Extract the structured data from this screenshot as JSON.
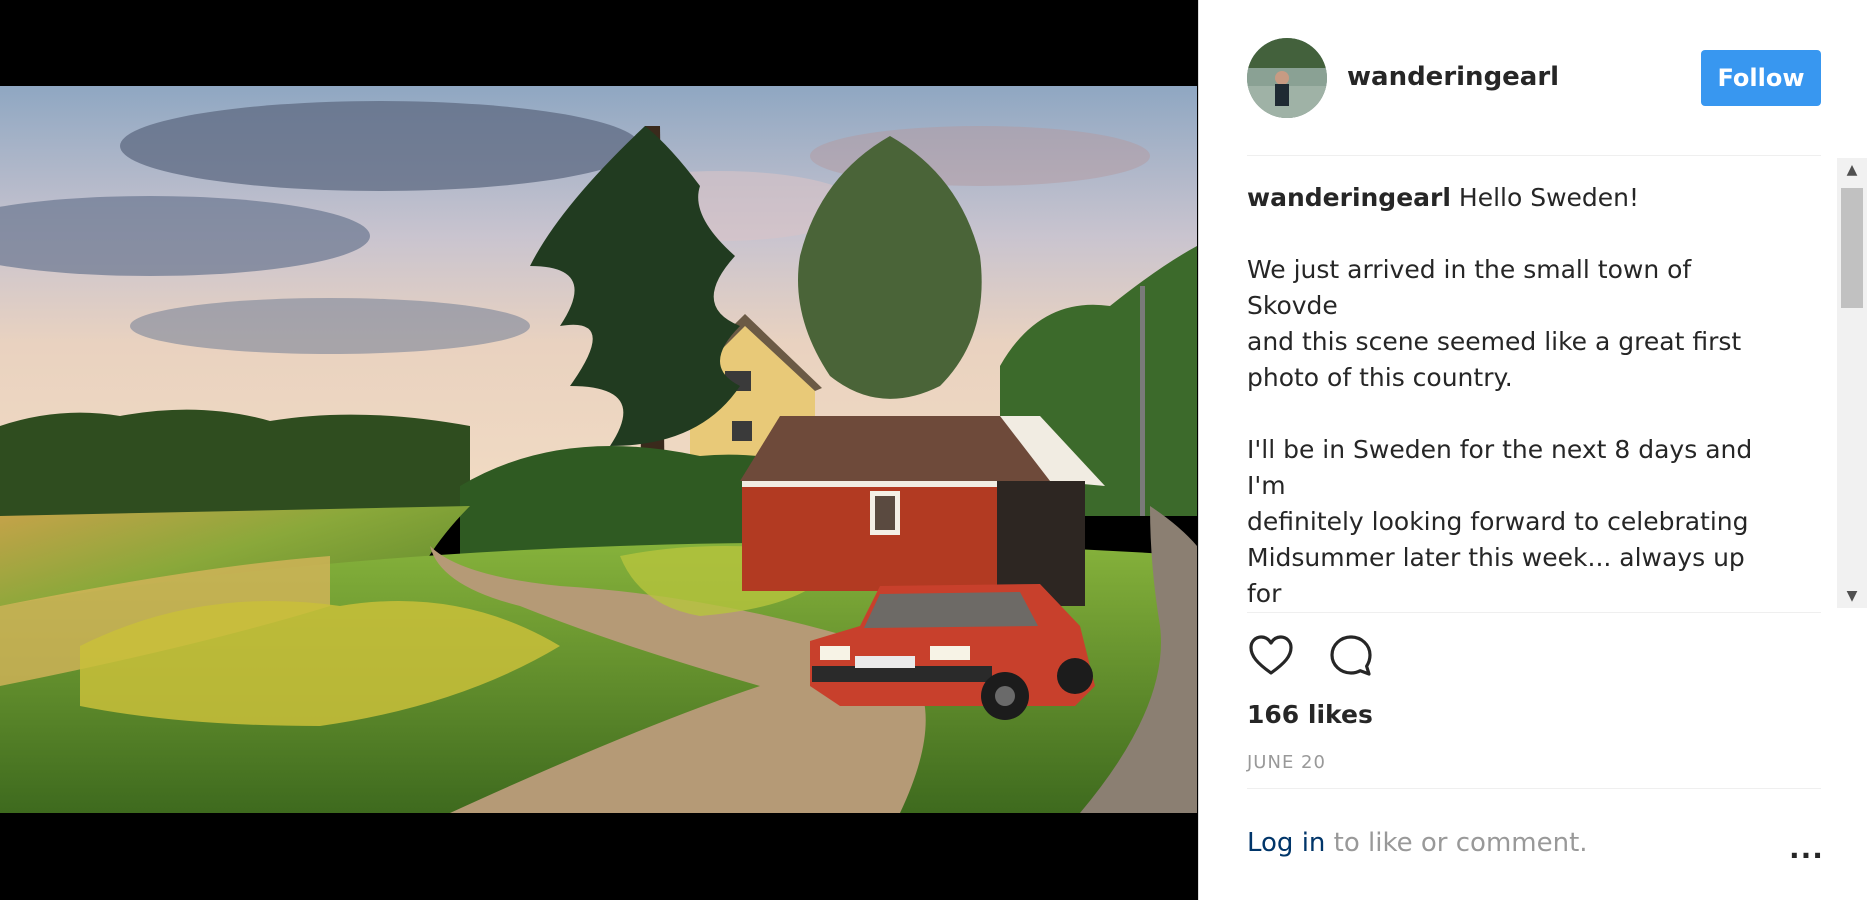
{
  "post": {
    "username": "wanderingearl",
    "follow_label": "Follow",
    "caption_greeting": "Hello Sweden!",
    "caption_body": "\n\nWe just arrived in the small town of Skovde\nand this scene seemed like a great first\nphoto of this country.\n\nI'll be in Sweden for the next 8 days and I'm\ndefinitely looking forward to celebrating\nMidsummer later this week... always up for\na festival!\n\nDo you have any favorite festivals you've",
    "likes": "166 likes",
    "date": "JUNE 20",
    "login_link": "Log in",
    "login_suffix": " to like or comment.",
    "more_label": "..."
  },
  "icons": {
    "like": "heart-icon",
    "comment": "comment-icon",
    "scroll_up": "scroll-up-icon",
    "scroll_down": "scroll-down-icon",
    "more": "more-options-icon"
  },
  "colors": {
    "accent": "#3897f0",
    "link": "#003569",
    "text": "#262626",
    "muted": "#999999",
    "car": "#c8402c",
    "shed": "#b23a22"
  }
}
